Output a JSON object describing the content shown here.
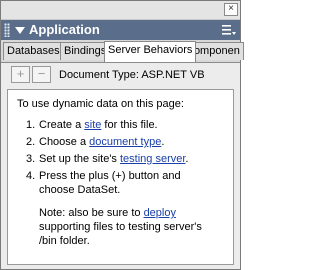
{
  "panel": {
    "title": "Application",
    "close_glyph": "×",
    "menu_icon": "options-menu-icon"
  },
  "tabs": [
    "Databases",
    "Bindings",
    "Server Behaviors",
    "Componen"
  ],
  "active_tab": "Server Behaviors",
  "toolbar": {
    "add_glyph": "+",
    "remove_glyph": "−",
    "doctype_label": "Document Type: ASP.NET VB"
  },
  "instructions": {
    "intro": "To use dynamic data on this page:",
    "step1": {
      "num": "1.",
      "pre": "Create a ",
      "link": "site",
      "post": " for this file."
    },
    "step2": {
      "num": "2.",
      "pre": "Choose a ",
      "link": "document type",
      "post": "."
    },
    "step3": {
      "num": "3.",
      "pre": "Set up the site's ",
      "link": "testing server",
      "post": "."
    },
    "step4": {
      "num": "4.",
      "line1": "Press the plus (+) button and",
      "line2": "choose DataSet."
    },
    "note": {
      "pre": "Note: also be sure to ",
      "link": "deploy",
      "line2": "supporting files to testing server's",
      "line3": "/bin folder."
    }
  },
  "colors": {
    "titlebar": "#5a6e8c",
    "link": "#1a3fa8"
  }
}
